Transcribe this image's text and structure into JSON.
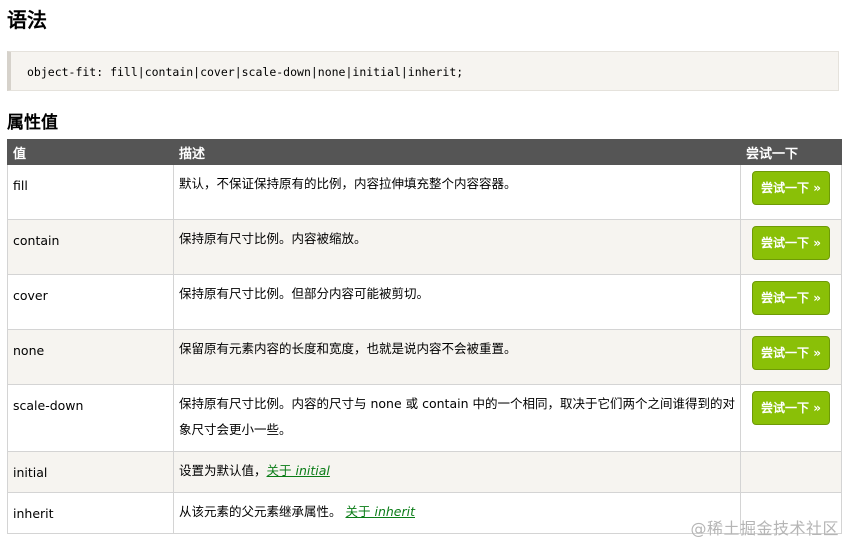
{
  "heading_syntax": "语法",
  "syntax_code": "object-fit: fill|contain|cover|scale-down|none|initial|inherit;",
  "heading_values": "属性值",
  "table": {
    "headers": [
      "值",
      "描述",
      "尝试一下"
    ],
    "rows": [
      {
        "value": "fill",
        "desc": "默认，不保证保持原有的比例，内容拉伸填充整个内容容器。",
        "button": "尝试一下 »"
      },
      {
        "value": "contain",
        "desc": "保持原有尺寸比例。内容被缩放。",
        "button": "尝试一下 »"
      },
      {
        "value": "cover",
        "desc": "保持原有尺寸比例。但部分内容可能被剪切。",
        "button": "尝试一下 »"
      },
      {
        "value": "none",
        "desc": "保留原有元素内容的长度和宽度，也就是说内容不会被重置。",
        "button": "尝试一下 »"
      },
      {
        "value": "scale-down",
        "desc": "保持原有尺寸比例。内容的尺寸与 none 或 contain 中的一个相同，取决于它们两个之间谁得到的对象尺寸会更小一些。",
        "button": "尝试一下 »"
      },
      {
        "value": "initial",
        "desc": "设置为默认值，",
        "link_prefix": "关于 ",
        "link_word": "initial"
      },
      {
        "value": "inherit",
        "desc": "从该元素的父元素继承属性。 ",
        "link_prefix": "关于 ",
        "link_word": "inherit"
      }
    ]
  },
  "watermark": "@稀土掘金技术社区",
  "colors": {
    "header_bg": "#555555",
    "button_green": "#8ac007",
    "link_green": "#0a7c17",
    "alt_row": "#f6f4f0"
  }
}
